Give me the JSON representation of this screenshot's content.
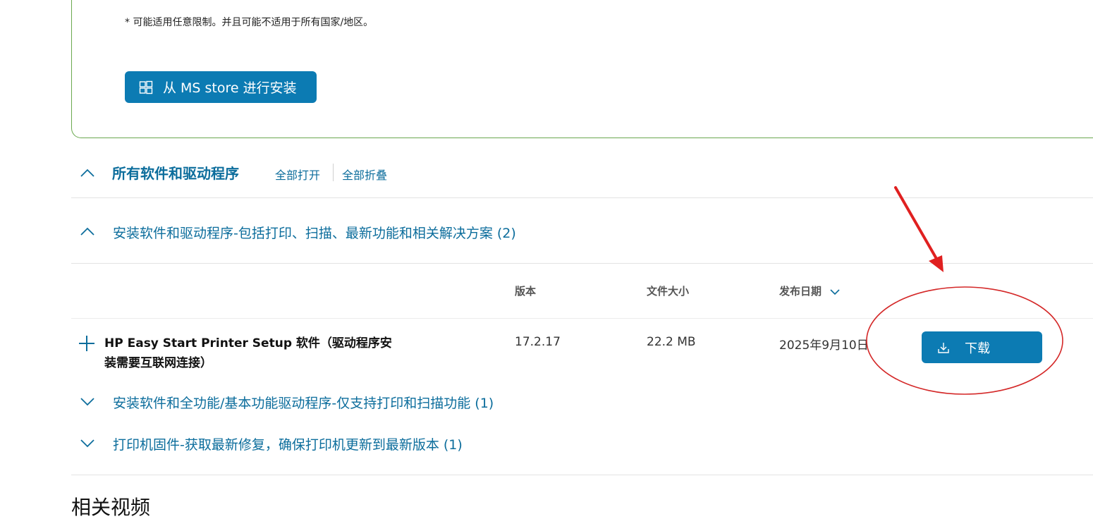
{
  "store_card": {
    "note": "* 可能适用任意限制。并且可能不适用于所有国家/地区。",
    "ms_store_button": "从 MS store 进行安装",
    "ms_store_icon": "windows-logo-icon"
  },
  "all_software": {
    "title": "所有软件和驱动程序",
    "expand_all": "全部打开",
    "collapse_all": "全部折叠"
  },
  "categories": [
    {
      "title": "安装软件和驱动程序-包括打印、扫描、最新功能和相关解决方案 (2)",
      "expanded": true
    },
    {
      "title": "安装软件和全功能/基本功能驱动程序-仅支持打印和扫描功能 (1)",
      "expanded": false
    },
    {
      "title": "打印机固件-获取最新修复，确保打印机更新到最新版本 (1)",
      "expanded": false
    }
  ],
  "table": {
    "headers": {
      "version": "版本",
      "file_size": "文件大小",
      "release_date": "发布日期"
    },
    "rows": [
      {
        "name": "HP Easy Start Printer Setup 软件（驱动程序安装需要互联网连接）",
        "version": "17.2.17",
        "file_size": "22.2 MB",
        "release_date": "2025年9月10日",
        "download_label": "下载"
      }
    ]
  },
  "related_videos": "相关视频",
  "colors": {
    "primary_blue": "#0c7bb3",
    "link_blue": "#0c6d9c",
    "card_border_green": "#6aa84f",
    "annotation_red": "#e02020"
  }
}
